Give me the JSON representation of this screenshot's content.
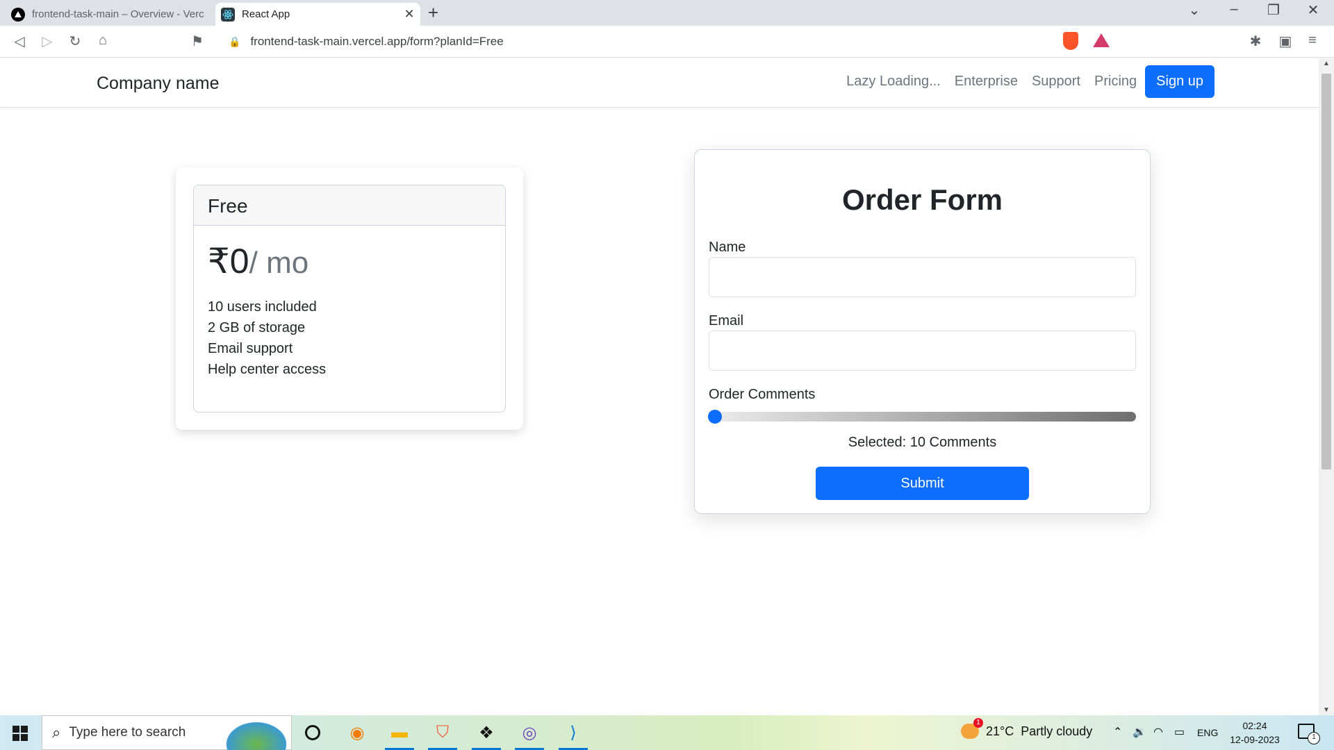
{
  "browser": {
    "tabs": [
      {
        "title": "frontend-task-main – Overview - Verc",
        "favicon": "vercel-icon"
      },
      {
        "title": "React App",
        "favicon": "react-icon"
      }
    ],
    "url": "frontend-task-main.vercel.app/form?planId=Free"
  },
  "navbar": {
    "brand": "Company name",
    "links": [
      "Lazy Loading...",
      "Enterprise",
      "Support",
      "Pricing"
    ],
    "signup_label": "Sign up"
  },
  "plan": {
    "name": "Free",
    "price": "₹0",
    "unit": "/ mo",
    "features": [
      "10 users included",
      "2 GB of storage",
      "Email support",
      "Help center access"
    ]
  },
  "form": {
    "title": "Order Form",
    "name_label": "Name",
    "name_value": "",
    "email_label": "Email",
    "email_value": "",
    "comments_label": "Order Comments",
    "comments_slider_value": 10,
    "selected_text": "Selected: 10 Comments",
    "submit_label": "Submit"
  },
  "taskbar": {
    "search_placeholder": "Type here to search",
    "apps": [
      "cortana-icon",
      "blender-icon",
      "file-explorer-icon",
      "brave-icon",
      "dropbox-icon",
      "github-desktop-icon",
      "vscode-icon"
    ],
    "weather_temp": "21°C",
    "weather_desc": "Partly cloudy",
    "language": "ENG",
    "time": "02:24",
    "date": "12-09-2023",
    "notification_count": "1"
  },
  "colors": {
    "primary": "#0d6efd",
    "text": "#212529",
    "muted": "#6c757d"
  }
}
